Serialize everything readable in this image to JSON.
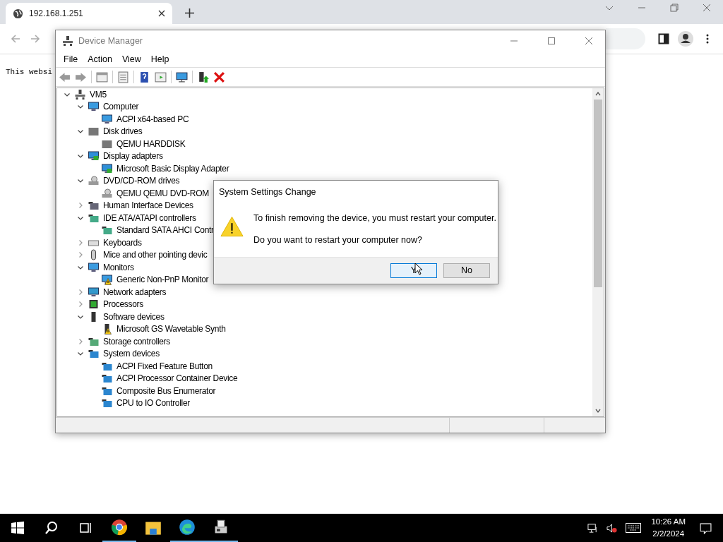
{
  "browser": {
    "tab": {
      "title": "192.168.1.251"
    },
    "page_text": "This websi"
  },
  "device_manager": {
    "title": "Device Manager",
    "menu": [
      "File",
      "Action",
      "View",
      "Help"
    ],
    "tree": [
      {
        "label": "VM5",
        "kind": "host",
        "expanded": true,
        "children": [
          {
            "label": "Computer",
            "kind": "monitor",
            "expanded": true,
            "children": [
              {
                "label": "ACPI x64-based PC",
                "kind": "monitor"
              }
            ]
          },
          {
            "label": "Disk drives",
            "kind": "disk",
            "expanded": true,
            "children": [
              {
                "label": "QEMU HARDDISK",
                "kind": "disk"
              }
            ]
          },
          {
            "label": "Display adapters",
            "kind": "display",
            "expanded": true,
            "children": [
              {
                "label": "Microsoft Basic Display Adapter",
                "kind": "display"
              }
            ]
          },
          {
            "label": "DVD/CD-ROM drives",
            "kind": "dvd",
            "expanded": true,
            "children": [
              {
                "label": "QEMU QEMU DVD-ROM",
                "kind": "dvd"
              }
            ]
          },
          {
            "label": "Human Interface Devices",
            "kind": "hid",
            "expanded": false
          },
          {
            "label": "IDE ATA/ATAPI controllers",
            "kind": "ide",
            "expanded": true,
            "children": [
              {
                "label": "Standard SATA AHCI Contr",
                "kind": "ide"
              }
            ]
          },
          {
            "label": "Keyboards",
            "kind": "keyboard",
            "expanded": false
          },
          {
            "label": "Mice and other pointing devic",
            "kind": "mouse",
            "expanded": false
          },
          {
            "label": "Monitors",
            "kind": "monitor",
            "expanded": true,
            "children": [
              {
                "label": "Generic Non-PnP Monitor",
                "kind": "monitor",
                "warning": true
              }
            ]
          },
          {
            "label": "Network adapters",
            "kind": "network",
            "expanded": false
          },
          {
            "label": "Processors",
            "kind": "processor",
            "expanded": false
          },
          {
            "label": "Software devices",
            "kind": "software",
            "expanded": true,
            "children": [
              {
                "label": "Microsoft GS Wavetable Synth",
                "kind": "software",
                "warning": true
              }
            ]
          },
          {
            "label": "Storage controllers",
            "kind": "storage",
            "expanded": false
          },
          {
            "label": "System devices",
            "kind": "system",
            "expanded": true,
            "children": [
              {
                "label": "ACPI Fixed Feature Button",
                "kind": "system"
              },
              {
                "label": "ACPI Processor Container Device",
                "kind": "system"
              },
              {
                "label": "Composite Bus Enumerator",
                "kind": "system"
              },
              {
                "label": "CPU to IO Controller",
                "kind": "system"
              }
            ]
          }
        ]
      }
    ]
  },
  "dialog": {
    "title": "System Settings Change",
    "message": "To finish removing the device, you must restart your computer.",
    "question": "Do you want to restart your computer now?",
    "buttons": [
      {
        "label": "Y",
        "selected": true
      },
      {
        "label": "No",
        "selected": false
      }
    ]
  },
  "taskbar": {
    "time": "10:26 AM",
    "date": "2/2/2024"
  }
}
